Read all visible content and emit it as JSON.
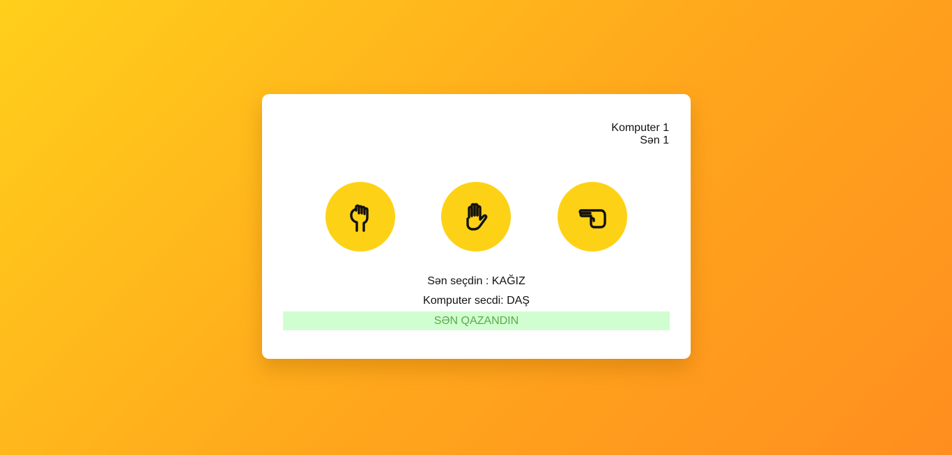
{
  "score": {
    "computer": "Komputer 1",
    "user": "Sən 1"
  },
  "choices": [
    {
      "name": "rock",
      "icon": "fist-icon"
    },
    {
      "name": "paper",
      "icon": "open-hand-icon"
    },
    {
      "name": "scissors",
      "icon": "scissors-hand-icon"
    }
  ],
  "result": {
    "user_choice": "Sən seçdin : KAĞIZ",
    "computer_choice": "Komputer secdi: DAŞ",
    "message": "SƏN QAZANDIN"
  },
  "colors": {
    "accent": "#fdd216",
    "banner_bg": "#d1fed0",
    "banner_text": "#5ca84a"
  }
}
